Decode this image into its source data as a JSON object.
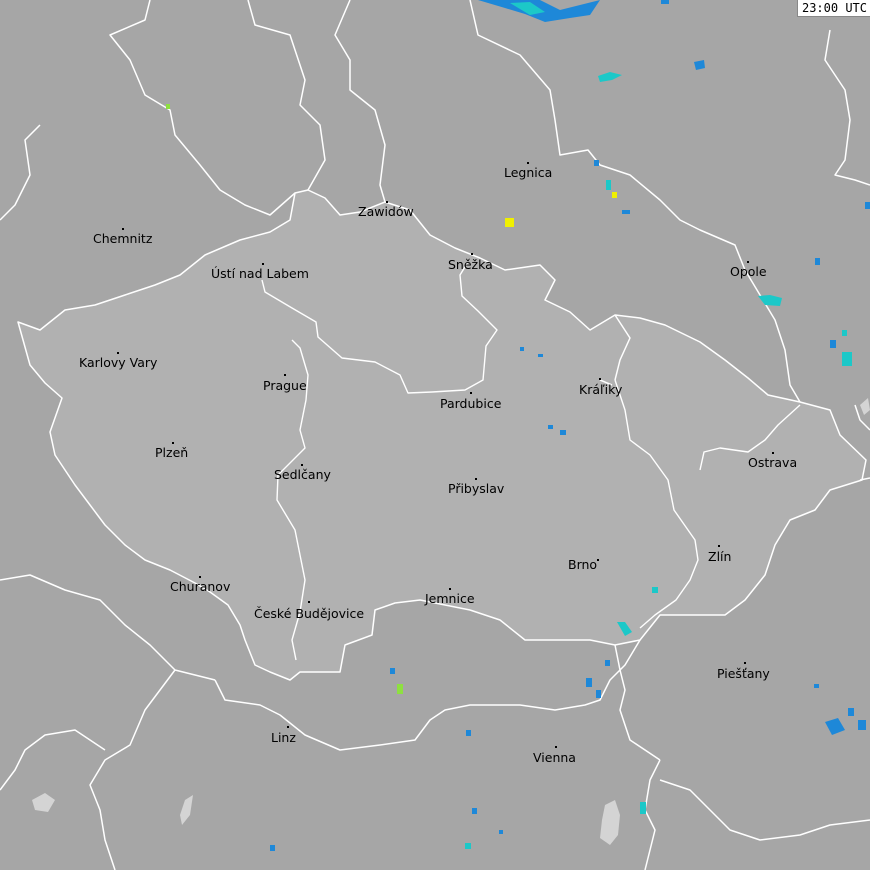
{
  "time_label": "23:00 UTC",
  "colors": {
    "background": "#a6a6a6",
    "country": "#b1b1b1",
    "border": "#ffffff",
    "label": "#000000",
    "radar_blue": "#1e88d8",
    "radar_cyan": "#1cc8c8",
    "radar_yellow": "#f0f000",
    "radar_green": "#8ee040"
  },
  "cities": [
    {
      "name": "Zawidów"
    },
    {
      "name": "Legnica"
    },
    {
      "name": "Chemnitz"
    },
    {
      "name": "Ústí nad Labem"
    },
    {
      "name": "Sněžka"
    },
    {
      "name": "Opole"
    },
    {
      "name": "Karlovy Vary"
    },
    {
      "name": "Prague"
    },
    {
      "name": "Kráľiky"
    },
    {
      "name": "Pardubice"
    },
    {
      "name": "Plzeň"
    },
    {
      "name": "Ostrava"
    },
    {
      "name": "Sedlčany"
    },
    {
      "name": "Přibyslav"
    },
    {
      "name": "Zlín"
    },
    {
      "name": "Brno"
    },
    {
      "name": "Churanov"
    },
    {
      "name": "Jemnice"
    },
    {
      "name": "České Budějovice"
    },
    {
      "name": "Piešťany"
    },
    {
      "name": "Linz"
    },
    {
      "name": "Vienna"
    }
  ]
}
